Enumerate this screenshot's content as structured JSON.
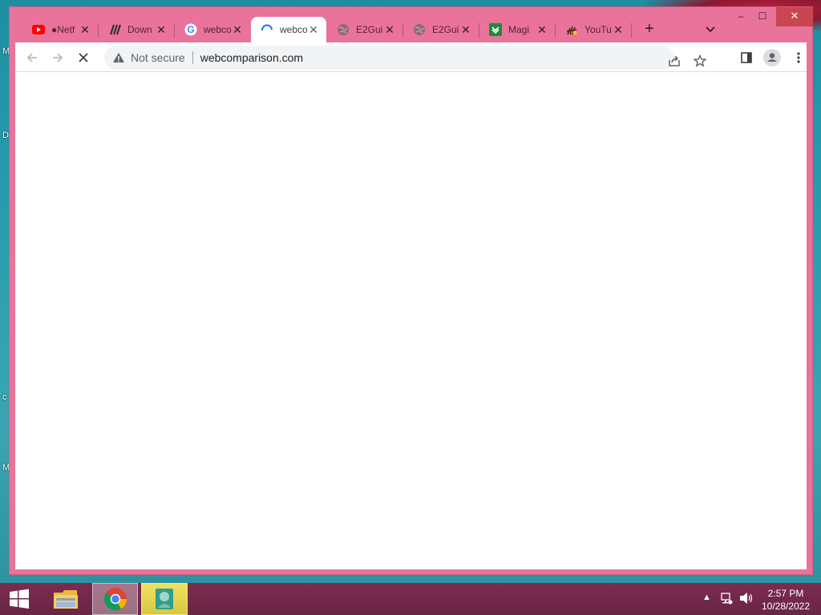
{
  "desktop": {
    "edge_letters": [
      "M",
      "D",
      "c",
      "M"
    ]
  },
  "browser": {
    "tabs": [
      {
        "title": "●Netf",
        "favicon": "youtube-icon",
        "active": false
      },
      {
        "title": "Down",
        "favicon": "slash-logo-icon",
        "active": false
      },
      {
        "title": "webco",
        "favicon": "google-icon",
        "active": false
      },
      {
        "title": "webco",
        "favicon": "loading-spinner-icon",
        "active": true
      },
      {
        "title": "E2Gui",
        "favicon": "globe-icon",
        "active": false
      },
      {
        "title": "E2Gui",
        "favicon": "globe-icon",
        "active": false
      },
      {
        "title": "Magi",
        "favicon": "magi-icon",
        "active": false
      },
      {
        "title": "YouTu",
        "favicon": "hand-icon",
        "active": false
      }
    ],
    "new_tab_label": "+",
    "window_controls": {
      "minimize": "–",
      "maximize": "☐",
      "close": "✕"
    },
    "toolbar": {
      "back_icon": "arrow-left-icon",
      "forward_icon": "arrow-right-icon",
      "stop_icon": "close-icon",
      "security_label": "Not secure",
      "url": "webcomparison.com"
    }
  },
  "taskbar": {
    "time": "2:57 PM",
    "date": "10/28/2022",
    "apps": [
      "start-menu",
      "file-explorer",
      "google-chrome",
      "app"
    ]
  },
  "colors": {
    "window_frame": "#e9739a",
    "taskbar": "#6f2748",
    "desktop": "#2a9fb0"
  }
}
